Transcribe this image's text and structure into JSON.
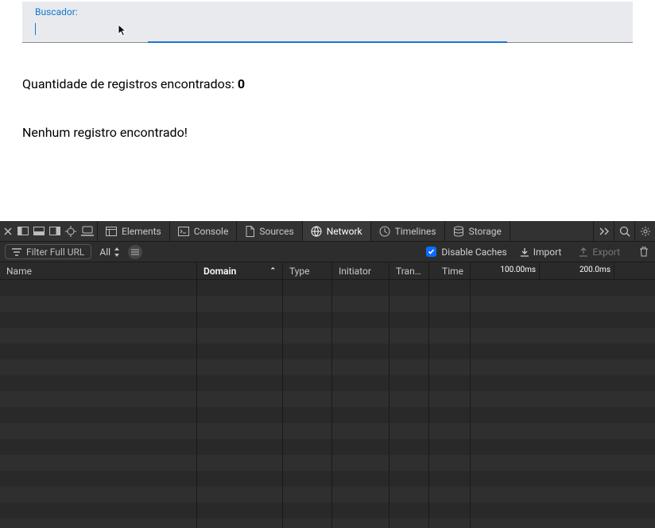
{
  "app": {
    "search_label": "Buscador:",
    "count_prefix": "Quantidade de registros encontrados: ",
    "count_value": "0",
    "empty_message": "Nenhum registro encontrado!"
  },
  "devtools": {
    "tabs": {
      "elements": "Elements",
      "console": "Console",
      "sources": "Sources",
      "network": "Network",
      "timelines": "Timelines",
      "storage": "Storage"
    },
    "filter": {
      "placeholder": "Filter Full URL",
      "scope": "All",
      "disable_caches": "Disable Caches",
      "import": "Import",
      "export": "Export"
    },
    "columns": {
      "name": "Name",
      "domain": "Domain",
      "type": "Type",
      "initiator": "Initiator",
      "transferred": "Tran…",
      "time": "Time"
    },
    "timeline": {
      "tick100": "100.00ms",
      "tick200": "200.0ms"
    }
  }
}
